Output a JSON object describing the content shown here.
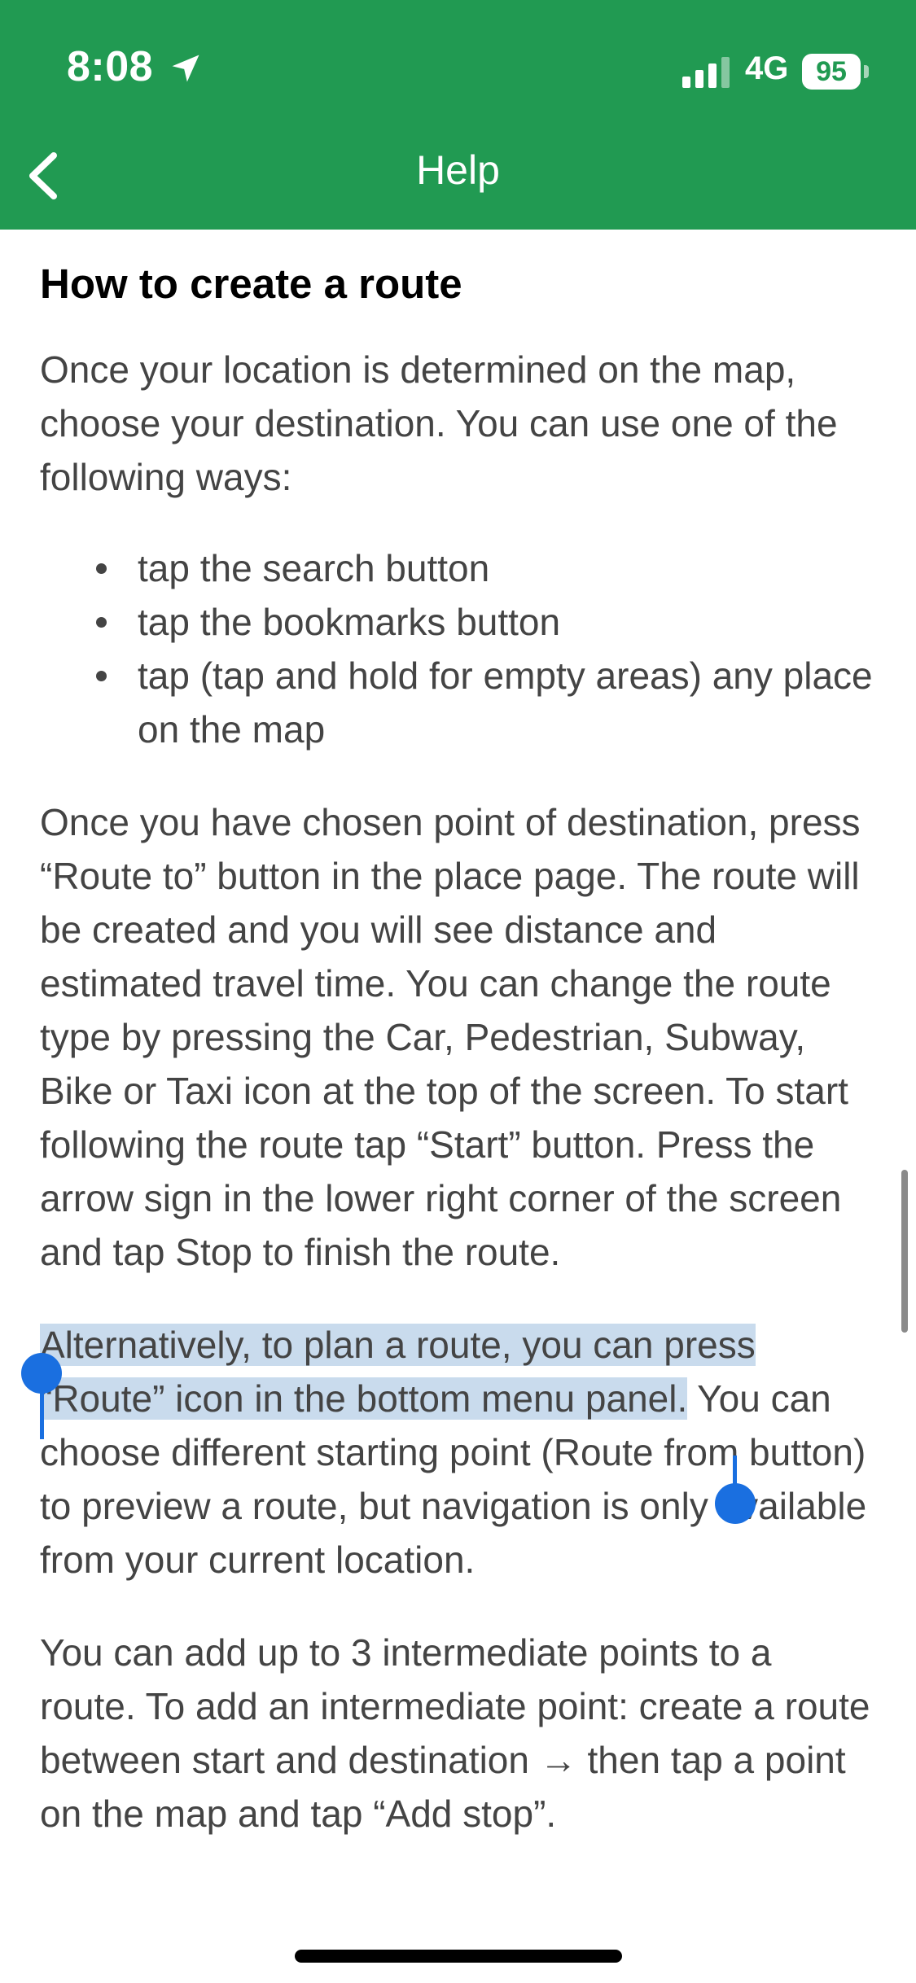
{
  "status_bar": {
    "time": "8:08",
    "network": "4G",
    "battery": "95"
  },
  "nav": {
    "title": "Help",
    "back_icon": "chevron-left-icon"
  },
  "article": {
    "heading": "How to create a route",
    "intro": "Once your location is determined on the map, choose your destination. You can use one of the following ways:",
    "bullets": [
      "tap the search button",
      "tap the bookmarks button",
      "tap (tap and hold for empty areas) any place on the map"
    ],
    "para2": "Once you have chosen point of destination, press “Route to” button in the place page. The route will be created and you will see distance and estimated travel time. You can change the route type by pressing the Car, Pedestrian, Subway, Bike or Taxi icon at the top of the screen. To start following the route tap “Start” button. Press the arrow sign in the lower right corner of the screen and tap Stop to finish the route.",
    "para3_selected": "Alternatively, to plan a route, you can press “Route” icon in the bottom menu panel.",
    "para3_rest": " You can choose different starting point (Route from button) to preview a route, but navigation is only available from your current location.",
    "para4": "You can add up to 3 intermediate points to a route. To add an intermediate point: create a route between start and destination → then tap a point on the map and tap “Add stop”."
  },
  "colors": {
    "header": "#219a52",
    "selection": "#c9dbed",
    "handle": "#1a6fe0",
    "text": "#444444"
  }
}
